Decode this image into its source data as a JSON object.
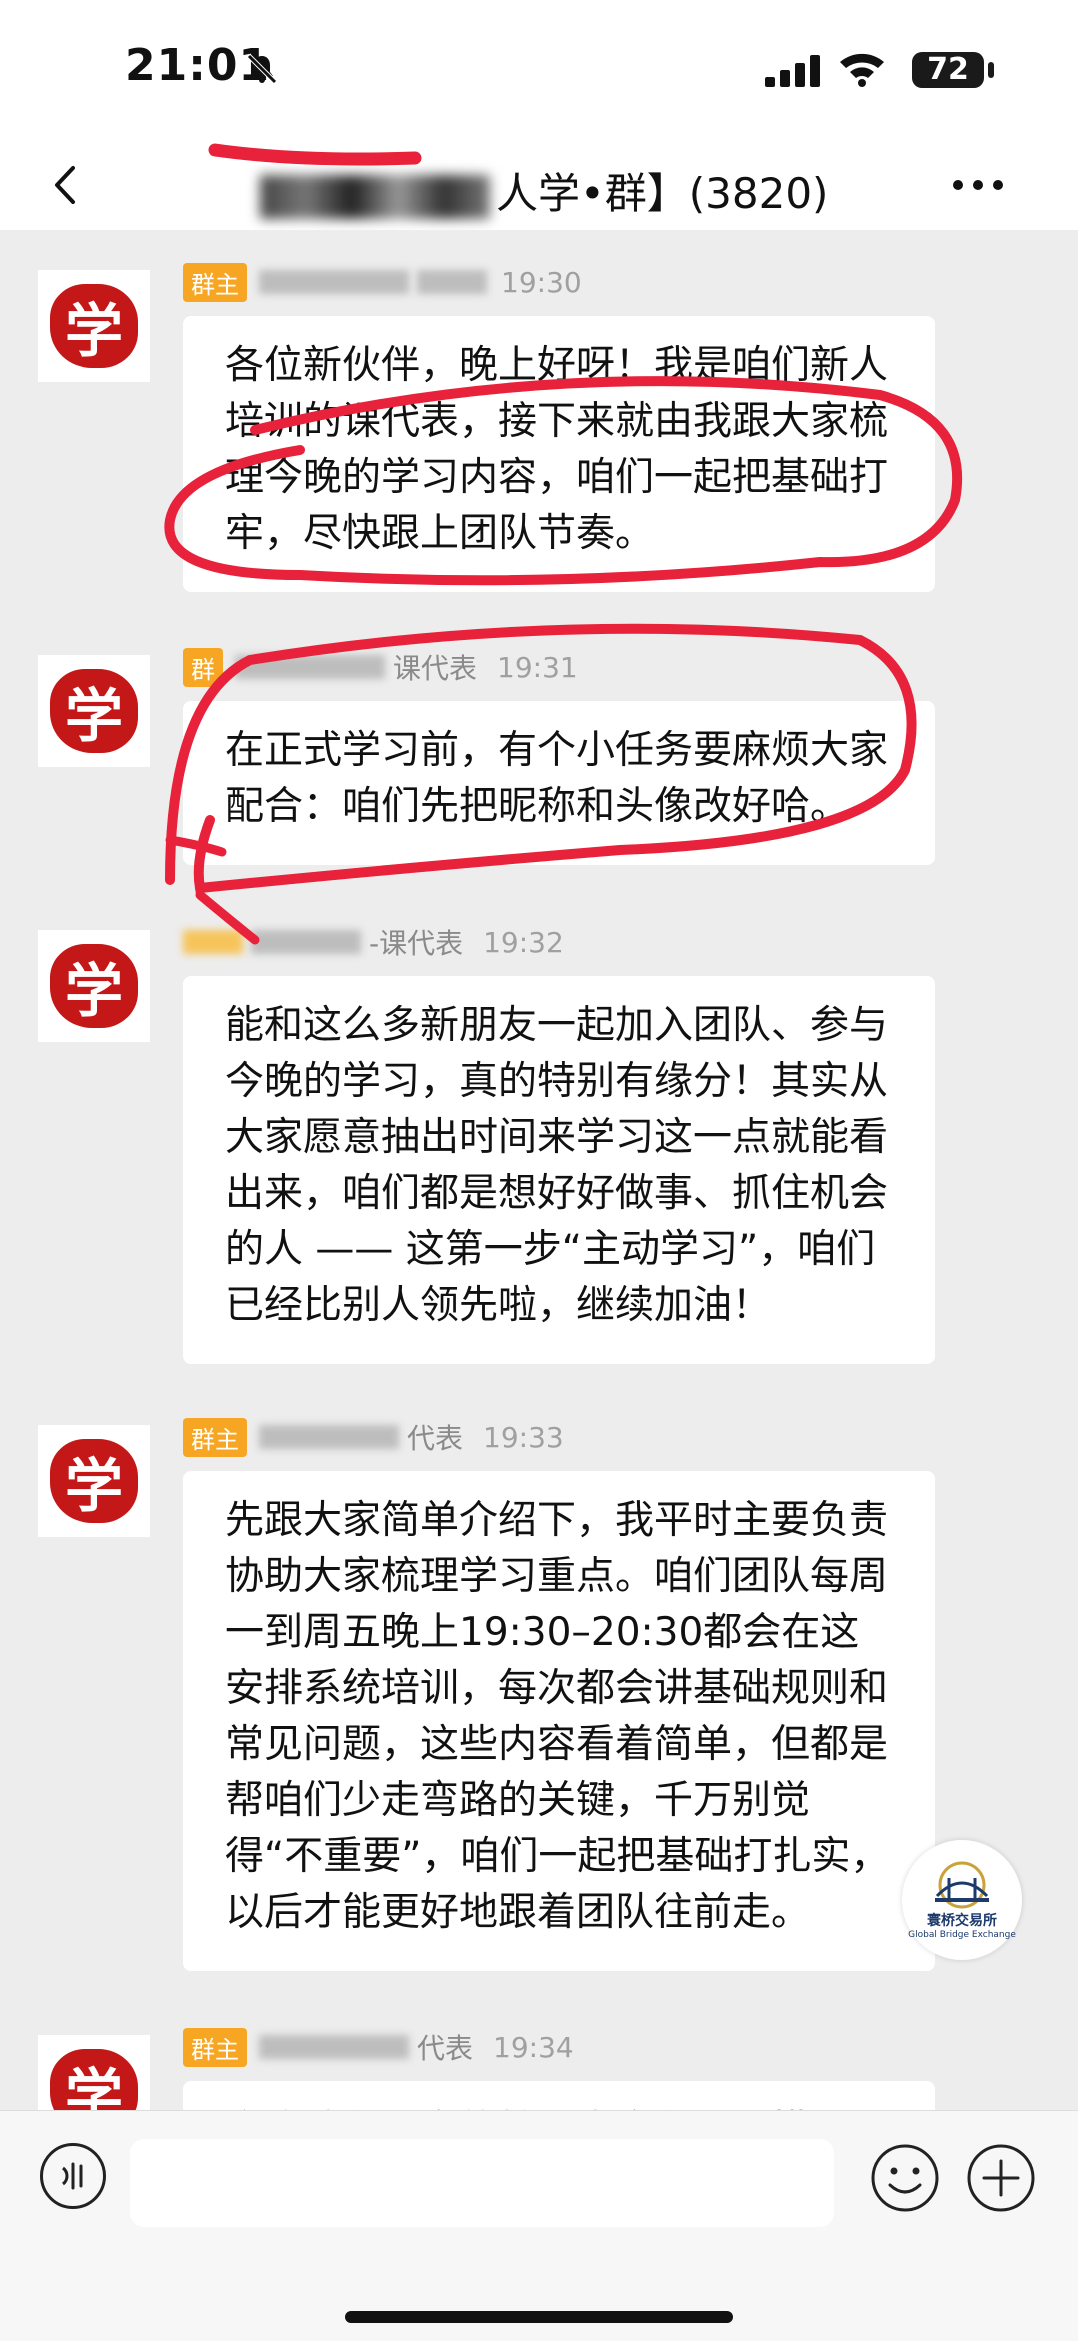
{
  "status_bar": {
    "time": "21:01",
    "battery": "72"
  },
  "header": {
    "title_visible": "人学•群】(3820)"
  },
  "messages": [
    {
      "badge": "群主",
      "name": "",
      "time": "19:30",
      "text": "各位新伙伴，晚上好呀！我是咱们新人培训的课代表，接下来就由我跟大家梳理今晚的学习内容，咱们一起把基础打牢，尽快跟上团队节奏。"
    },
    {
      "badge": "群",
      "name": "课代表",
      "time": "19:31",
      "text": "在正式学习前，有个小任务要麻烦大家配合：咱们先把昵称和头像改好哈。"
    },
    {
      "badge": "",
      "name": "-课代表",
      "time": "19:32",
      "text": "能和这么多新朋友一起加入团队、参与今晚的学习，真的特别有缘分！其实从大家愿意抽出时间来学习这一点就能看出来，咱们都是想好好做事、抓住机会的人 —— 这第一步“主动学习”，咱们已经比别人领先啦，继续加油！"
    },
    {
      "badge": "群主",
      "name": "代表",
      "time": "19:33",
      "text": "先跟大家简单介绍下，我平时主要负责协助大家梳理学习重点。咱们团队每周一到周五晚上19:30–20:30都会在这安排系统培训，每次都会讲基础规则和常见问题，这些内容看着简单，但都是帮咱们少走弯路的关键，千万别觉得“不重要”，咱们一起把基础打扎实，以后才能更好地跟着团队往前走。"
    },
    {
      "badge": "群主",
      "name": "代表",
      "time": "19:34",
      "text": "今晚咱们要学的核心内容有四个模块"
    }
  ],
  "avatar_char": "学",
  "watermark": {
    "name_cn": "寰桥交易所",
    "name_en": "Global Bridge Exchange"
  },
  "colors": {
    "annotation": "#e8223a",
    "badge": "#f6a623",
    "avatar": "#c41717"
  },
  "icons": [
    "bell-slash-icon",
    "signal-icon",
    "wifi-icon",
    "back-icon",
    "more-icon",
    "voice-icon",
    "emoji-icon",
    "plus-icon"
  ]
}
